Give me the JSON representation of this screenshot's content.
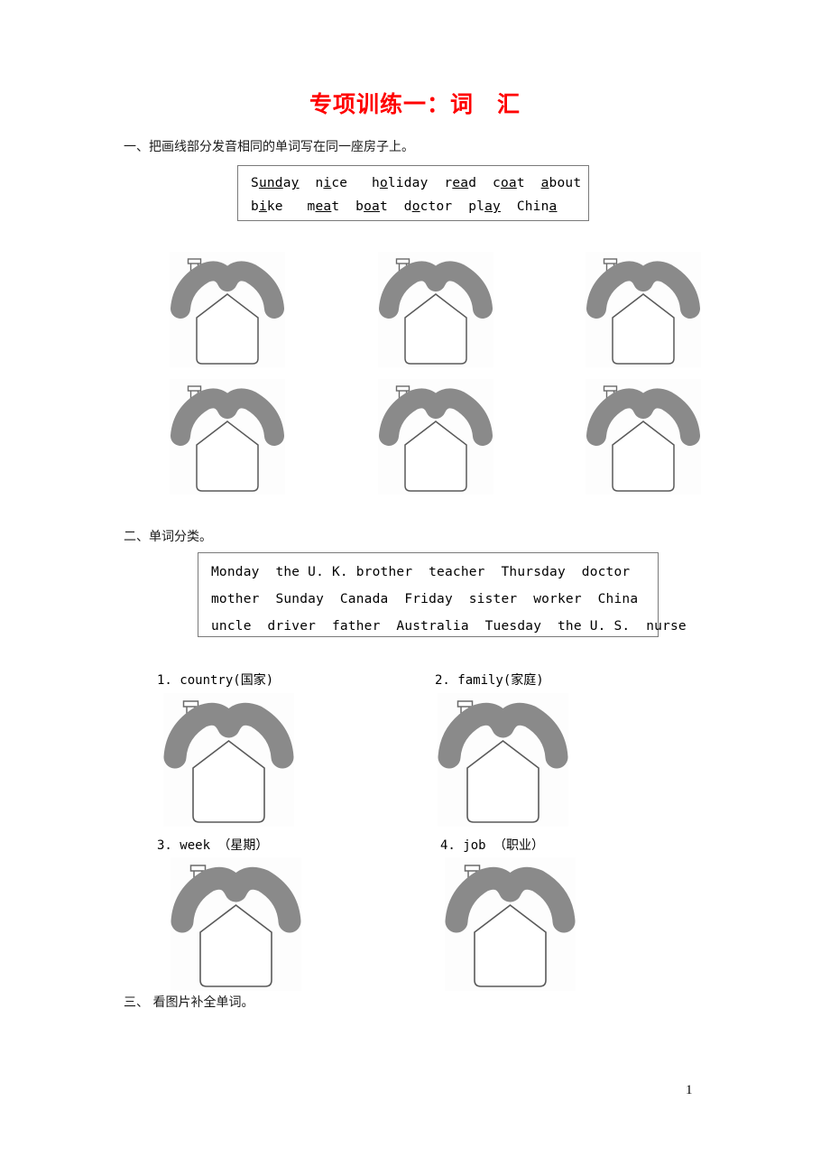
{
  "document": {
    "title": "专项训练一：词　汇",
    "title_color": "#ff0000",
    "page_number": "1"
  },
  "sections": [
    {
      "heading": "一、把画线部分发音相同的单词写在同一座房子上。",
      "word_bank_rows": [
        [
          {
            "pre": "S",
            "mark": "unda",
            "post": "y",
            "plain": "Sunday",
            "underline": "ay"
          },
          {
            "plain": "nice",
            "underline": "i"
          },
          {
            "plain": "holiday",
            "underline": "o"
          },
          {
            "plain": "read",
            "underline": "ea"
          },
          {
            "plain": "coat",
            "underline": "oa"
          },
          {
            "plain": "about",
            "underline": "a"
          }
        ],
        [
          {
            "plain": "bike",
            "underline": "i"
          },
          {
            "plain": "meat",
            "underline": "ea"
          },
          {
            "plain": "boat",
            "underline": "oa"
          },
          {
            "plain": "doctor",
            "underline": "o"
          },
          {
            "plain": "play",
            "underline": "ay"
          },
          {
            "plain": "China",
            "underline": "a"
          }
        ]
      ],
      "word_bank_row1_text": "Sunday  nice   holiday  read  coat  about",
      "word_bank_row2_text": "bike   meat  boat  doctor  play  China",
      "house_count": 6
    },
    {
      "heading": "二、单词分类。",
      "word_bank_rows_text": [
        "Monday  the U. K. brother  teacher  Thursday  doctor",
        "mother  Sunday  Canada  Friday  sister  worker  China",
        "uncle  driver  father  Australia  Tuesday  the U. S.  nurse"
      ],
      "words": [
        "Monday",
        "the U. K.",
        "brother",
        "teacher",
        "Thursday",
        "doctor",
        "mother",
        "Sunday",
        "Canada",
        "Friday",
        "sister",
        "worker",
        "China",
        "uncle",
        "driver",
        "father",
        "Australia",
        "Tuesday",
        "the U. S.",
        "nurse"
      ],
      "categories": [
        {
          "number": "1.",
          "label": "country(国家)",
          "text": "1. country(国家)"
        },
        {
          "number": "2.",
          "label": "family(家庭)",
          "text": "2. family(家庭)"
        },
        {
          "number": "3.",
          "label": "week （星期）",
          "text": "3. week （星期）"
        },
        {
          "number": "4.",
          "label": "job （职业）",
          "text": "4. job （职业）"
        }
      ],
      "house_count": 4
    },
    {
      "heading": "三、 看图片补全单词。"
    }
  ],
  "icons": {
    "house": "house-icon",
    "roof_color": "#8a8a8a",
    "roof_stroke": "#4d4d4d",
    "body_stroke": "#5a5a5a",
    "body_fill": "#ffffff",
    "tile_bg": "#fdfdfd"
  }
}
